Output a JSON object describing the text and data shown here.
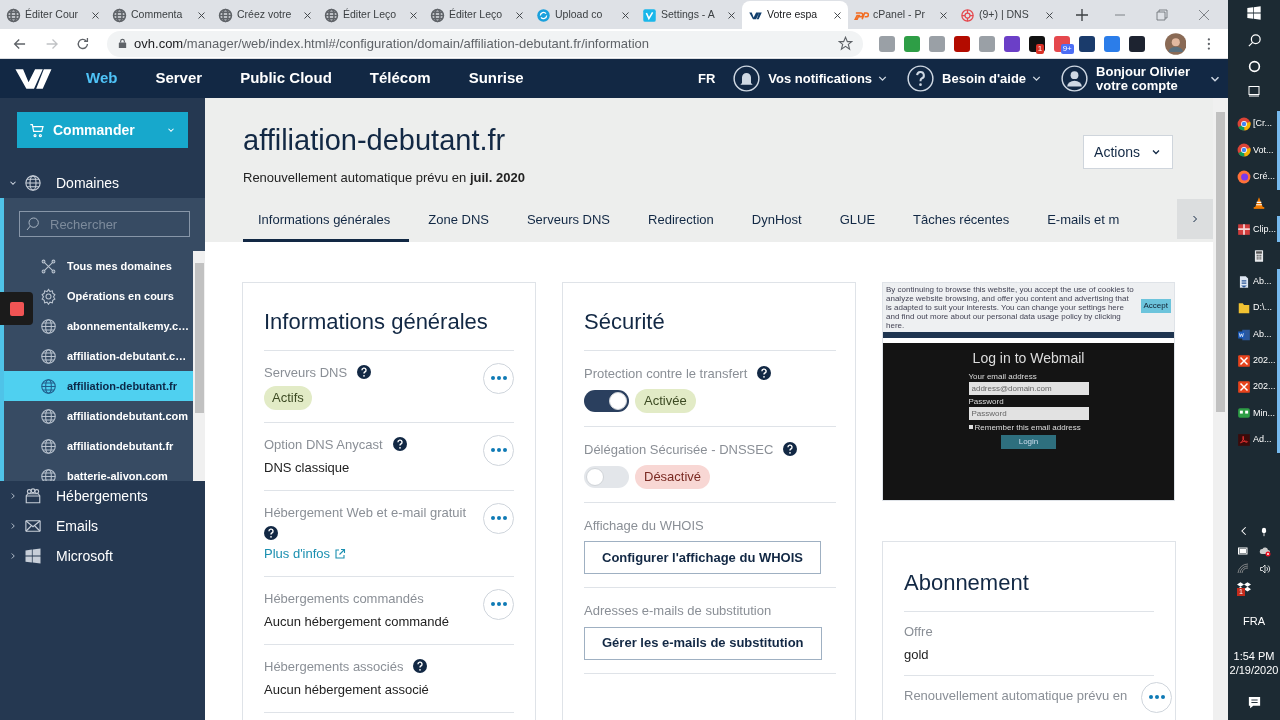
{
  "browser": {
    "tabs": [
      {
        "label": "Éditer Cour",
        "kind": "globe",
        "selected": false
      },
      {
        "label": "Commenta",
        "kind": "globe",
        "selected": false
      },
      {
        "label": "Créez votre",
        "kind": "globe",
        "selected": false
      },
      {
        "label": "Éditer Leço",
        "kind": "globe",
        "selected": false
      },
      {
        "label": "Éditer Leço",
        "kind": "globe",
        "selected": false
      },
      {
        "label": "Upload co",
        "kind": "sync",
        "selected": false
      },
      {
        "label": "Settings - A",
        "kind": "video",
        "selected": false
      },
      {
        "label": "Votre espa",
        "kind": "ovh",
        "selected": true
      },
      {
        "label": "cPanel - Pr",
        "kind": "cpanel",
        "selected": false
      },
      {
        "label": "(9+) | DNS",
        "kind": "ring",
        "selected": false
      }
    ],
    "url_host": "ovh.com",
    "url_path": "/manager/web/index.html#/configuration/domain/affiliation-debutant.fr/information",
    "extension_badges": [
      "1",
      "9+"
    ]
  },
  "topnav": {
    "items": [
      {
        "label": "Web",
        "selected": true
      },
      {
        "label": "Server",
        "selected": false
      },
      {
        "label": "Public Cloud",
        "selected": false
      },
      {
        "label": "Télécom",
        "selected": false
      },
      {
        "label": "Sunrise",
        "selected": false
      }
    ],
    "language": "FR",
    "notifications": "Vos notifications",
    "help": "Besoin d'aide",
    "greeting": "Bonjour Olivier",
    "account": "votre compte"
  },
  "sidebar": {
    "order_button": "Commander",
    "sections": [
      {
        "label": "Domaines",
        "kind": "globe",
        "expanded": true,
        "search_placeholder": "Rechercher",
        "items": [
          {
            "label": "Tous mes domaines",
            "kind": "tools",
            "selected": false
          },
          {
            "label": "Opérations en cours",
            "kind": "gear",
            "selected": false
          },
          {
            "label": "abonnementalkemy.c…",
            "kind": "globe",
            "selected": false
          },
          {
            "label": "affiliation-debutant.c…",
            "kind": "globe",
            "selected": false
          },
          {
            "label": "affiliation-debutant.fr",
            "kind": "globe",
            "selected": true
          },
          {
            "label": "affiliationdebutant.com",
            "kind": "globe",
            "selected": false
          },
          {
            "label": "affiliationdebutant.fr",
            "kind": "globe",
            "selected": false
          },
          {
            "label": "batterie-alivon.com",
            "kind": "globe",
            "selected": false
          }
        ]
      },
      {
        "label": "Hébergements",
        "kind": "people",
        "expanded": false
      },
      {
        "label": "Emails",
        "kind": "mail",
        "expanded": false
      },
      {
        "label": "Microsoft",
        "kind": "windows",
        "expanded": false
      }
    ]
  },
  "header": {
    "title": "affiliation-debutant.fr",
    "renewal": "Renouvellement automatique prévu en **juil. 2020**",
    "actions": "Actions"
  },
  "tabs": [
    {
      "label": "Informations générales",
      "selected": true
    },
    {
      "label": "Zone DNS",
      "selected": false
    },
    {
      "label": "Serveurs DNS",
      "selected": false
    },
    {
      "label": "Redirection",
      "selected": false
    },
    {
      "label": "DynHost",
      "selected": false
    },
    {
      "label": "GLUE",
      "selected": false
    },
    {
      "label": "Tâches récentes",
      "selected": false
    },
    {
      "label": "E-mails et m",
      "selected": false
    }
  ],
  "general": {
    "title": "Informations générales",
    "rows": [
      {
        "label": "Serveurs DNS",
        "help": true,
        "menu": true,
        "kind": "badge",
        "value": "Actifs"
      },
      {
        "label": "Option DNS Anycast",
        "help": true,
        "menu": true,
        "kind": "text",
        "value": "DNS classique"
      },
      {
        "label": "Hébergement Web et e-mail gratuit",
        "help": true,
        "menu": true,
        "kind": "link",
        "value": "Plus d'infos"
      },
      {
        "label": "Hébergements commandés",
        "help": false,
        "menu": true,
        "kind": "text",
        "value": "Aucun hébergement commandé"
      },
      {
        "label": "Hébergements associés",
        "help": true,
        "menu": false,
        "kind": "text",
        "value": "Aucun hébergement associé"
      }
    ]
  },
  "security": {
    "title": "Sécurité",
    "rows": [
      {
        "label": "Protection contre le transfert",
        "kind": "toggle",
        "on": true,
        "value": "Activée"
      },
      {
        "label": "Délégation Sécurisée - DNSSEC",
        "kind": "toggle",
        "on": false,
        "value": "Désactivé"
      },
      {
        "label": "Affichage du WHOIS",
        "kind": "button",
        "value": "Configurer l'affichage du WHOIS"
      },
      {
        "label": "Adresses e-mails de substitution",
        "kind": "button",
        "value": "Gérer les e-mails de substitution"
      }
    ]
  },
  "webmail_preview": {
    "cookie_text": "By continuing to browse this website, you accept the use of cookies to analyze website browsing, and offer you content and advertising that is adapted to suit your interests. You can change your settings here and find out more about our personal data usage policy by clicking here.",
    "accept": "Accept",
    "title": "Log in to Webmail",
    "email_label": "Your email address",
    "email_placeholder": "address@domain.com",
    "password_label": "Password",
    "password_placeholder": "Password",
    "remember": "Remember this email address",
    "remember_checked": false,
    "login": "Login"
  },
  "subscription": {
    "title": "Abonnement",
    "offer_label": "Offre",
    "offer": "gold",
    "renewal_label": "Renouvellement automatique prévu en"
  },
  "taskbar": {
    "apps": [
      {
        "kind": "chrome",
        "label": "[Cr..."
      },
      {
        "kind": "chrome",
        "label": "Vot..."
      },
      {
        "kind": "firefox",
        "label": "Cré..."
      },
      {
        "kind": "cone"
      },
      {
        "kind": "gift",
        "label": "Clip..."
      },
      {
        "kind": "calc"
      },
      {
        "kind": "doc",
        "label": "Ab..."
      },
      {
        "kind": "folder",
        "label": "D:\\..."
      },
      {
        "kind": "word",
        "label": "Ab..."
      },
      {
        "kind": "cross",
        "label": "202..."
      },
      {
        "kind": "cross",
        "label": "202..."
      },
      {
        "kind": "mini",
        "label": "Min..."
      },
      {
        "kind": "pdf",
        "label": "Ad..."
      }
    ],
    "dropbox_badge": "1",
    "language": "FRA",
    "time": "1:54 PM",
    "date": "2/19/2020"
  }
}
